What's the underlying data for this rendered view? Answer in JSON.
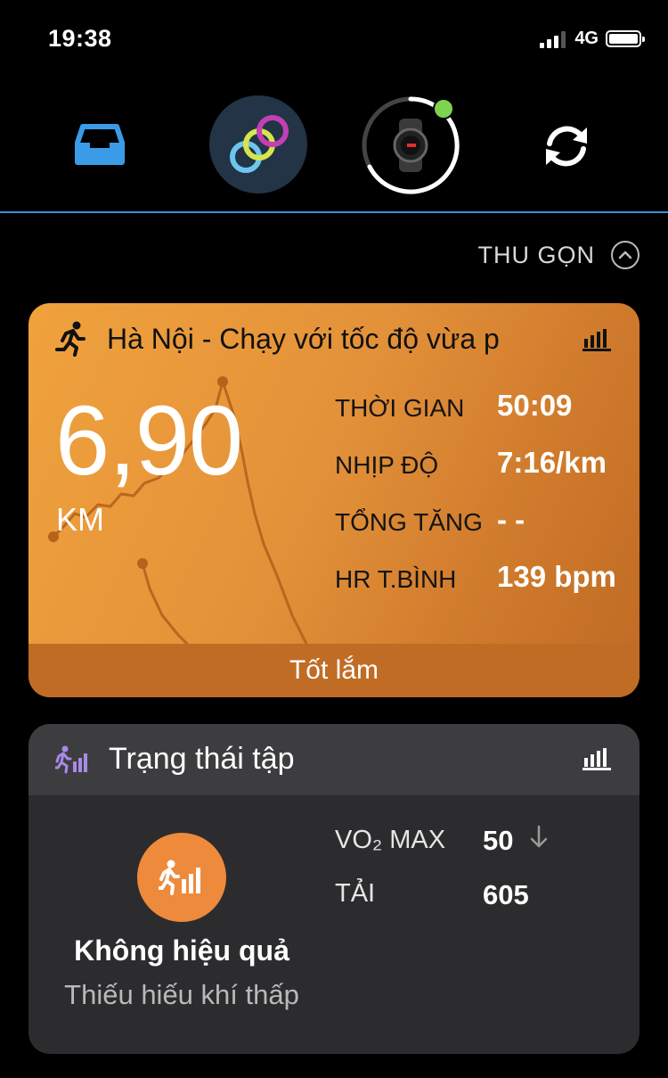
{
  "status_bar": {
    "time": "19:38",
    "network": "4G"
  },
  "top_nav": {
    "items": [
      {
        "name": "inbox",
        "icon": "inbox-icon"
      },
      {
        "name": "connect",
        "icon": "linked-rings-icon"
      },
      {
        "name": "device",
        "icon": "watch-icon",
        "connected": true
      },
      {
        "name": "sync",
        "icon": "sync-icon"
      }
    ]
  },
  "collapse": {
    "label": "THU GỌN"
  },
  "activity": {
    "title": "Hà Nội - Chạy với tốc độ vừa p",
    "distance": "6,90",
    "distance_unit": "KM",
    "stats": [
      {
        "label": "THỜI GIAN",
        "value": "50:09"
      },
      {
        "label": "NHỊP ĐỘ",
        "value": "7:16/km"
      },
      {
        "label": "TỔNG TĂNG",
        "value": "- -"
      },
      {
        "label": "HR T.BÌNH",
        "value": "139 bpm"
      }
    ],
    "feedback": "Tốt lắm",
    "accent": "#e8963a"
  },
  "training_status": {
    "title": "Trạng thái tập",
    "status_name": "Không hiệu quả",
    "status_desc": "Thiếu hiếu khí thấp",
    "vo2_label": "VO₂ MAX",
    "vo2_value": "50",
    "vo2_trend": "down",
    "load_label": "TẢI",
    "load_value": "605",
    "status_color": "#ee8a3b"
  }
}
